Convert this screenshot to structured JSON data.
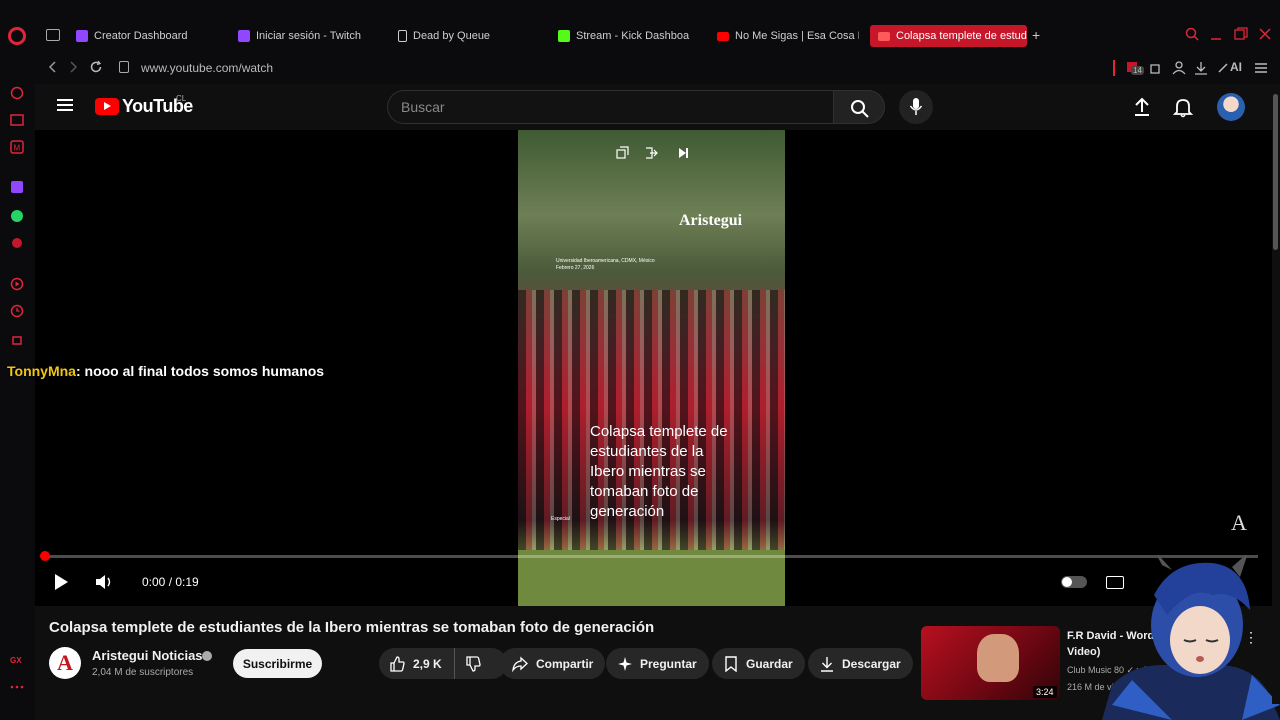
{
  "browser": {
    "tabs": [
      {
        "label": "Creator Dashboard",
        "icon": "twitch-icon",
        "color": "#9146ff"
      },
      {
        "label": "Iniciar sesión - Twitch",
        "icon": "twitch-icon",
        "color": "#9146ff"
      },
      {
        "label": "Dead by Queue",
        "icon": "document-icon",
        "color": "#cccccc"
      },
      {
        "label": "Stream - Kick Dashboa",
        "icon": "kick-icon",
        "color": "#53fc18"
      },
      {
        "label": "No Me Sigas | Esa Cosa N",
        "icon": "youtube-icon",
        "color": "#ff0000"
      },
      {
        "label": "Colapsa templete de estud",
        "icon": "youtube-icon",
        "color": "#ff0000",
        "active": true
      }
    ],
    "url": "www.youtube.com/watch",
    "extension_badge": "14",
    "ai_label": "AI"
  },
  "youtube": {
    "logo_text": "YouTube",
    "country": "CL",
    "search_placeholder": "Buscar"
  },
  "player": {
    "time": "0:00 / 0:19",
    "progress": 0.0,
    "chat_user": "TonnyMna",
    "chat_message": ": nooo al final todos somos humanos",
    "frame": {
      "brand": "Aristegui",
      "location_line1": "Universidad Iberoamericana, CDMX, México",
      "location_line2": "Febrero 27, 2026",
      "caption": "Colapsa templete de estudiantes de la Ibero mientras se tomaban foto de generación",
      "credit": "Especial"
    },
    "watermark": "A"
  },
  "video": {
    "title": "Colapsa templete de estudiantes de la Ibero mientras se tomaban foto de generación",
    "channel": "Aristegui Noticias",
    "channel_initial": "A",
    "subscribers": "2,04 M de suscriptores",
    "subscribe_label": "Suscribirme",
    "likes": "2,9 K",
    "share_label": "Compartir",
    "ask_label": "Preguntar",
    "save_label": "Guardar",
    "download_label": "Descargar"
  },
  "recommended": {
    "title": "F.R David - Word Video)",
    "channel": "Club Music 80 ✓ y F.R",
    "views": "216 M de visualiz",
    "duration": "3:24"
  },
  "colors": {
    "accent": "#ff0000",
    "opera": "#e0263b",
    "active_tab": "#c5162a",
    "chat_user": "#f0c419"
  }
}
